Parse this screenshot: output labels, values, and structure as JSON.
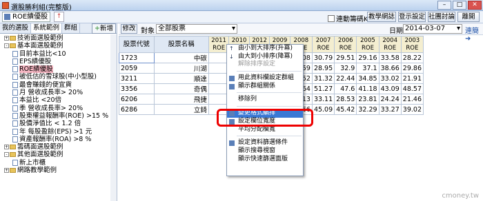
{
  "window": {
    "title": "選股勝利組(完整版)"
  },
  "toolbar": {
    "strategy": "ROE績優股",
    "checkbox_label": "連動籌碼K",
    "buttons": [
      "教學網誌",
      "登示設定",
      "社團討論",
      "離開"
    ]
  },
  "left": {
    "tabs": [
      "我的選股",
      "系統範例",
      "群組"
    ],
    "new_label": "新增",
    "tree": [
      {
        "t": "技術面選股範例",
        "lvl": 0,
        "type": "folder",
        "exp": "+"
      },
      {
        "t": "基本面選股範例",
        "lvl": 0,
        "type": "folder",
        "exp": "-"
      },
      {
        "t": "目前本益比<10",
        "lvl": 1,
        "type": "doc"
      },
      {
        "t": "EPS績優股",
        "lvl": 1,
        "type": "doc"
      },
      {
        "t": "ROE績優股",
        "lvl": 1,
        "type": "doc",
        "sel": true
      },
      {
        "t": "被低估的雪球股(中小型股)",
        "lvl": 1,
        "type": "doc"
      },
      {
        "t": "最會賺錢的便宜貨",
        "lvl": 1,
        "type": "doc"
      },
      {
        "t": "月 營收成長率> 20%",
        "lvl": 1,
        "type": "doc"
      },
      {
        "t": "本益比 <20倍",
        "lvl": 1,
        "type": "doc"
      },
      {
        "t": "季 營收成長率> 20%",
        "lvl": 1,
        "type": "doc"
      },
      {
        "t": "股東權益報酬率(ROE) >15 %",
        "lvl": 1,
        "type": "doc"
      },
      {
        "t": "股價淨值比 < 1.2 倍",
        "lvl": 1,
        "type": "doc"
      },
      {
        "t": "年 每股盈餘(EPS) >1 元",
        "lvl": 1,
        "type": "doc"
      },
      {
        "t": "資產報酬率(ROA) >8 %",
        "lvl": 1,
        "type": "doc"
      },
      {
        "t": "籌碼面選股範例",
        "lvl": 0,
        "type": "folder",
        "exp": "+"
      },
      {
        "t": "其他面選股範例",
        "lvl": 0,
        "type": "folder",
        "exp": "-"
      },
      {
        "t": "新上市櫃",
        "lvl": 1,
        "type": "doc"
      },
      {
        "t": "網路教學範例",
        "lvl": 0,
        "type": "folder",
        "exp": "+"
      }
    ]
  },
  "filter": {
    "edit": "修改",
    "object_label": "對象",
    "object_value": "全部股票",
    "date_label": "日期",
    "date_value": "2014-03-07",
    "link": "連簡"
  },
  "grid": {
    "headers": [
      "股票代號",
      "股票名稱"
    ],
    "years": [
      "2011 ROE",
      "2010 ROE",
      "2012 ROE",
      "2009 ROE",
      "2008 ROE",
      "2007 ROE",
      "2006 ROE",
      "2005 ROE",
      "2004 ROE",
      "2003 ROE"
    ],
    "rows": [
      {
        "code": "1723",
        "name": "中碳",
        "vals": [
          "",
          "",
          "",
          "",
          "31.08",
          "30.79",
          "29.51",
          "29.16",
          "33.58",
          "28.22"
        ]
      },
      {
        "code": "2059",
        "name": "川湖",
        "vals": [
          "",
          "",
          "",
          "",
          "30.59",
          "28.95",
          "32.9",
          "37.1",
          "38.66",
          "29.86"
        ]
      },
      {
        "code": "3211",
        "name": "順達",
        "vals": [
          "",
          "",
          "",
          "",
          "32.52",
          "31.32",
          "22.44",
          "34.85",
          "33.02",
          "21.91"
        ]
      },
      {
        "code": "3356",
        "name": "奇偶",
        "vals": [
          "",
          "",
          "",
          "",
          "47.64",
          "51.27",
          "47.6",
          "41.18",
          "43.09",
          "48.57"
        ]
      },
      {
        "code": "6206",
        "name": "飛捷",
        "vals": [
          "",
          "",
          "",
          "",
          "26.13",
          "33.11",
          "28.53",
          "23.81",
          "24.24",
          "21.46"
        ]
      },
      {
        "code": "6286",
        "name": "立錡",
        "vals": [
          "",
          "",
          "",
          "",
          "33.66",
          "45.09",
          "45.42",
          "32.29",
          "33.27",
          "39.02"
        ]
      }
    ]
  },
  "menu": {
    "items": [
      {
        "t": "由小到大排序(升冪)",
        "icon": "sort-asc-icon"
      },
      {
        "t": "由大到小排序(降冪)",
        "icon": "sort-desc-icon"
      },
      {
        "t": "解除排序設定",
        "dis": true
      },
      {
        "sep": true
      },
      {
        "t": "用此資料欄設定群組",
        "icon": "group-icon"
      },
      {
        "t": "顯示群組關係",
        "icon": "group-rel-icon"
      },
      {
        "sep": true
      },
      {
        "t": "移除列"
      },
      {
        "sep": true
      },
      {
        "t": "變更格式編排",
        "icon": "format-icon",
        "hi": true
      },
      {
        "t": "設定欄位寬度",
        "icon": "width-icon"
      },
      {
        "t": "平均分配欄寬"
      },
      {
        "sep": true
      },
      {
        "t": "設定資料篩選條件",
        "icon": "filter-icon"
      },
      {
        "t": "顯示搜尋視窗"
      },
      {
        "t": "顯示快速篩選面版"
      }
    ]
  },
  "watermark": "cmoney.tw"
}
